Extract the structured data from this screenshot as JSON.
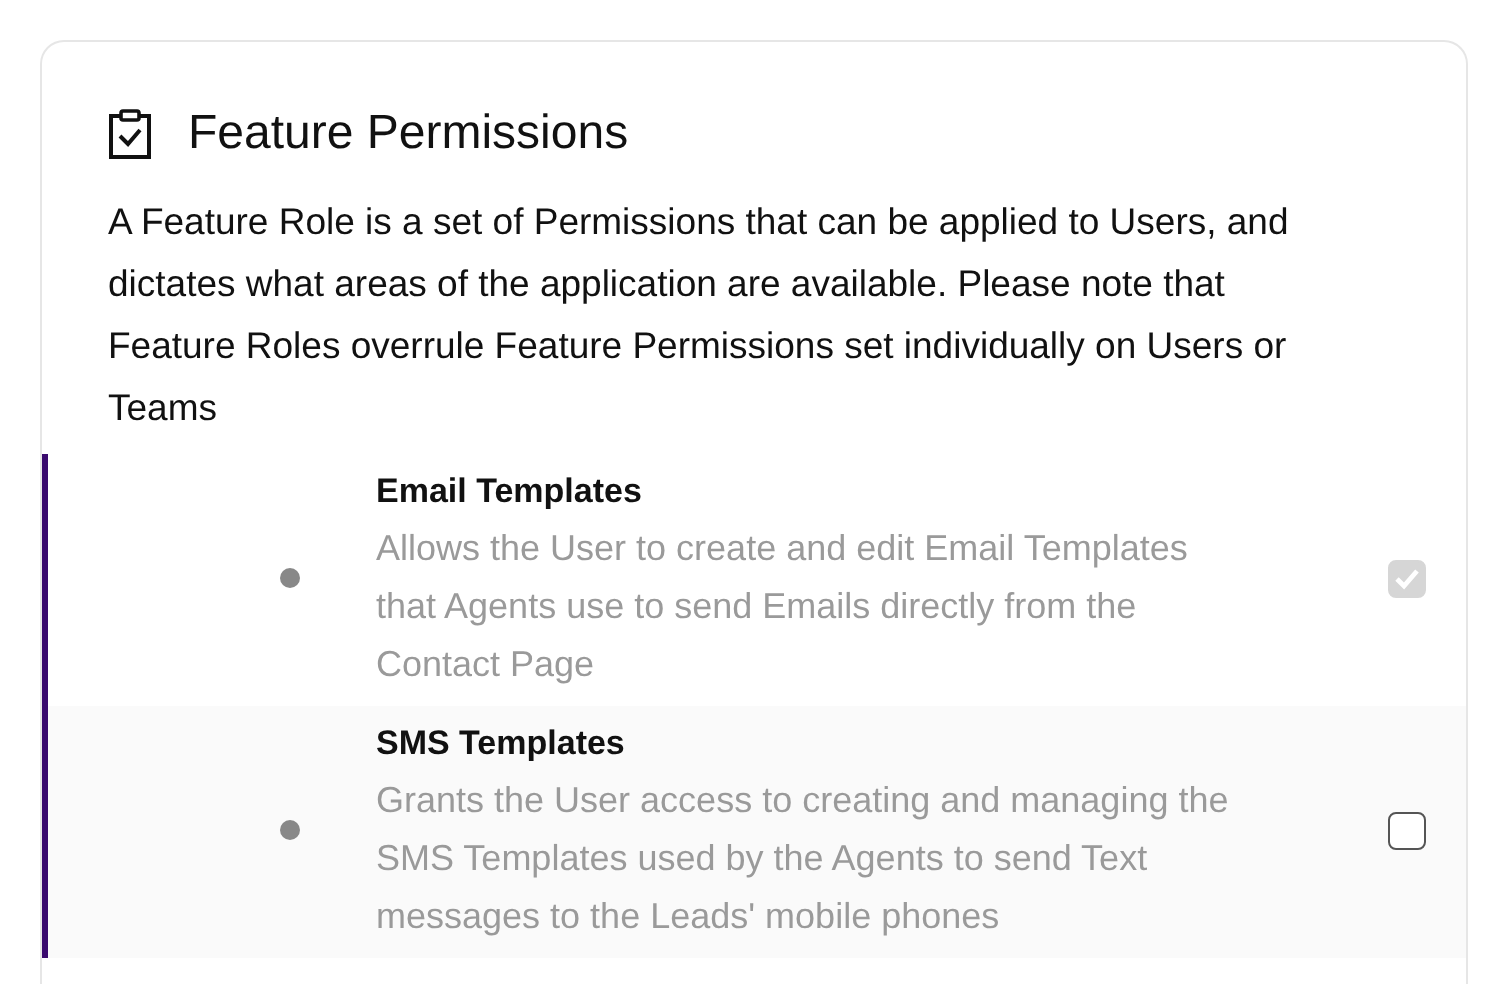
{
  "card": {
    "title": "Feature Permissions",
    "description": "A Feature Role is a set of Permissions that can be applied to Users, and dictates what areas of the application are available. Please note that Feature Roles overrule Feature Permissions set individually on Users or Teams"
  },
  "permissions": [
    {
      "name": "Email Templates",
      "description": "Allows the User to create and edit Email Templates that Agents use to send Emails directly from the Contact Page",
      "checked": true,
      "disabled": true
    },
    {
      "name": "SMS Templates",
      "description": "Grants the User access to creating and managing the SMS Templates used by the Agents to send Text messages to the Leads' mobile phones",
      "checked": false,
      "disabled": false
    }
  ]
}
